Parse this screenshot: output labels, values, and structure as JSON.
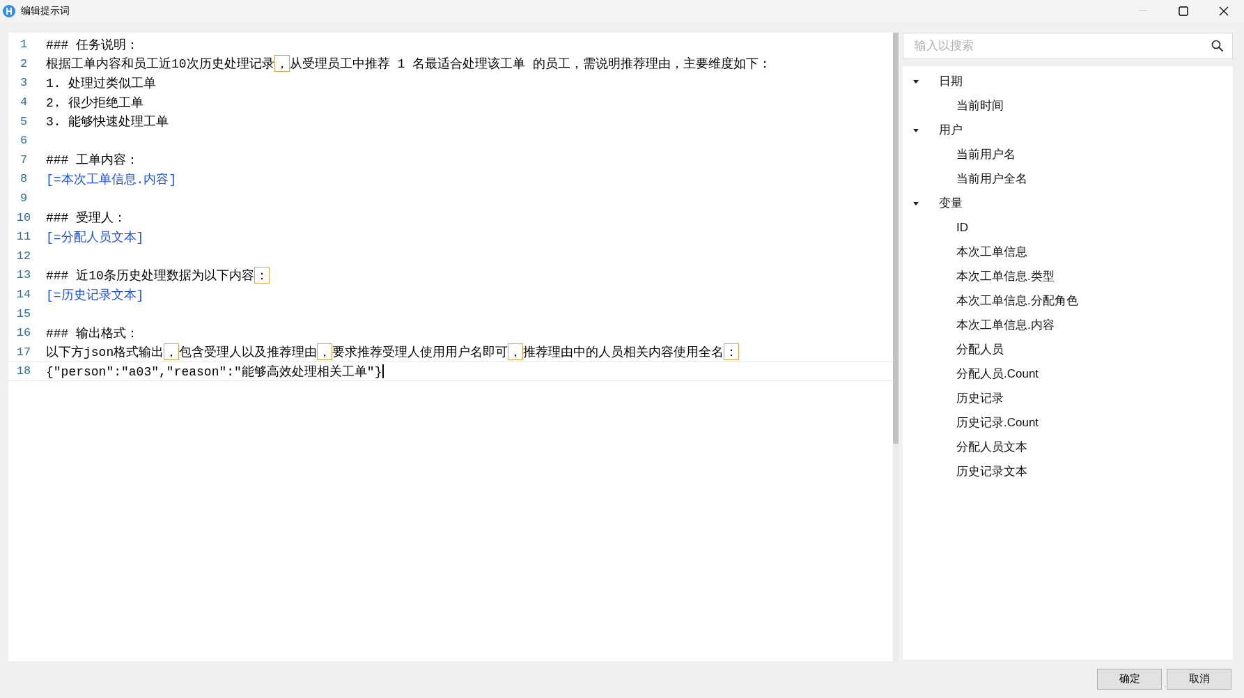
{
  "window": {
    "title": "编辑提示词",
    "minimize_disabled": true
  },
  "editor": {
    "lines": [
      {
        "number": "1",
        "current": false,
        "segments": [
          {
            "kind": "text",
            "text": "### 任务说明："
          }
        ]
      },
      {
        "number": "2",
        "current": false,
        "segments": [
          {
            "kind": "text",
            "text": "根据工单内容和员工近10次历史处理记录"
          },
          {
            "kind": "mark",
            "text": "，"
          },
          {
            "kind": "text",
            "text": "从受理员工中推荐 1 名最适合处理该工单 的员工，需说明推荐理由，主要维度如下："
          }
        ]
      },
      {
        "number": "3",
        "current": false,
        "segments": [
          {
            "kind": "text",
            "text": "1. 处理过类似工单"
          }
        ]
      },
      {
        "number": "4",
        "current": false,
        "segments": [
          {
            "kind": "text",
            "text": "2. 很少拒绝工单"
          }
        ]
      },
      {
        "number": "5",
        "current": false,
        "segments": [
          {
            "kind": "text",
            "text": "3. 能够快速处理工单"
          }
        ]
      },
      {
        "number": "6",
        "current": false
      },
      {
        "number": "7",
        "current": false,
        "segments": [
          {
            "kind": "text",
            "text": "### 工单内容："
          }
        ]
      },
      {
        "number": "8",
        "current": false,
        "segments": [
          {
            "kind": "variable",
            "text": "[=本次工单信息.内容]"
          }
        ]
      },
      {
        "number": "9",
        "current": false
      },
      {
        "number": "10",
        "current": false,
        "segments": [
          {
            "kind": "text",
            "text": "### 受理人："
          }
        ]
      },
      {
        "number": "11",
        "current": false,
        "segments": [
          {
            "kind": "variable",
            "text": "[=分配人员文本]"
          }
        ]
      },
      {
        "number": "12",
        "current": false
      },
      {
        "number": "13",
        "current": false,
        "segments": [
          {
            "kind": "text",
            "text": "### 近10条历史处理数据为以下内容"
          },
          {
            "kind": "mark",
            "text": "："
          }
        ]
      },
      {
        "number": "14",
        "current": false,
        "segments": [
          {
            "kind": "variable",
            "text": "[=历史记录文本]"
          }
        ]
      },
      {
        "number": "15",
        "current": false
      },
      {
        "number": "16",
        "current": false,
        "segments": [
          {
            "kind": "text",
            "text": "### 输出格式："
          }
        ]
      },
      {
        "number": "17",
        "current": false,
        "segments": [
          {
            "kind": "text",
            "text": "以下方json格式输出"
          },
          {
            "kind": "mark",
            "text": "，"
          },
          {
            "kind": "text",
            "text": "包含受理人以及推荐理由"
          },
          {
            "kind": "mark",
            "text": "，"
          },
          {
            "kind": "text",
            "text": "要求推荐受理人使用用户名即可"
          },
          {
            "kind": "mark",
            "text": "，"
          },
          {
            "kind": "text",
            "text": "推荐理由中的人员相关内容使用全名"
          },
          {
            "kind": "mark",
            "text": "："
          }
        ]
      },
      {
        "number": "18",
        "current": true,
        "segments": [
          {
            "kind": "text",
            "text": "{\"person\":\"a03\",\"reason\":\"能够高效处理相关工单\"}"
          }
        ]
      }
    ]
  },
  "search": {
    "placeholder": "输入以搜索"
  },
  "tree": [
    {
      "label": "日期",
      "expanded": true,
      "children": [
        {
          "label": "当前时间"
        }
      ]
    },
    {
      "label": "用户",
      "expanded": true,
      "children": [
        {
          "label": "当前用户名"
        },
        {
          "label": "当前用户全名"
        }
      ]
    },
    {
      "label": "变量",
      "expanded": true,
      "children": [
        {
          "label": "ID"
        },
        {
          "label": "本次工单信息"
        },
        {
          "label": "本次工单信息.类型"
        },
        {
          "label": "本次工单信息.分配角色"
        },
        {
          "label": "本次工单信息.内容"
        },
        {
          "label": "分配人员"
        },
        {
          "label": "分配人员.Count"
        },
        {
          "label": "历史记录"
        },
        {
          "label": "历史记录.Count"
        },
        {
          "label": "分配人员文本"
        },
        {
          "label": "历史记录文本"
        }
      ]
    }
  ],
  "buttons": [
    "确定",
    "取消"
  ]
}
